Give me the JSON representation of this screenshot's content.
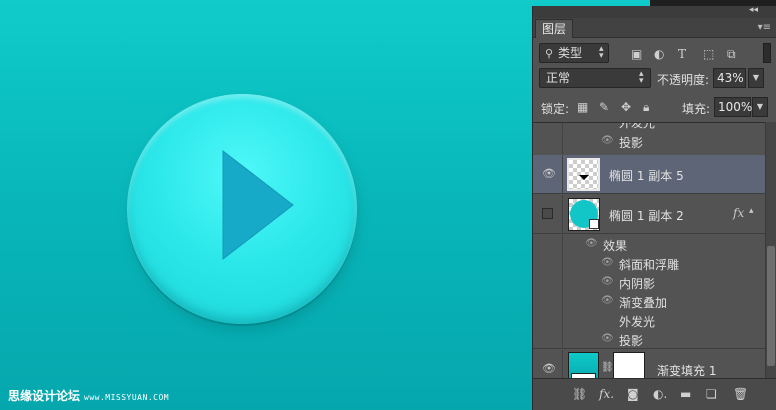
{
  "watermark": {
    "chinese": "思缘设计论坛",
    "url": "www.MISSYUAN.COM"
  },
  "panel": {
    "tab_title": "图层",
    "collapse_glyph": "◂◂",
    "close_glyph": "▸▸",
    "menu_glyph": "▾≡",
    "filter": {
      "label": "类型",
      "icons": [
        "image-filter-icon",
        "adjustment-filter-icon",
        "type-filter-icon",
        "shape-filter-icon",
        "smart-object-filter-icon"
      ]
    },
    "blend_mode": "正常",
    "opacity_label": "不透明度:",
    "opacity_value": "43%",
    "lock_label": "锁定:",
    "fill_label": "填充:",
    "fill_value": "100%",
    "layers": [
      {
        "type": "effect",
        "name": "外发光"
      },
      {
        "type": "effect",
        "name": "投影"
      },
      {
        "type": "layer",
        "name": "椭圆 1 副本 5",
        "selected": true,
        "visible": true
      },
      {
        "type": "layer",
        "name": "椭圆 1 副本 2",
        "selected": false,
        "visible": false,
        "fx": "fx"
      },
      {
        "type": "effects-header",
        "name": "效果"
      },
      {
        "type": "effect",
        "name": "斜面和浮雕"
      },
      {
        "type": "effect",
        "name": "内阴影"
      },
      {
        "type": "effect",
        "name": "渐变叠加"
      },
      {
        "type": "effect",
        "name": "外发光"
      },
      {
        "type": "effect",
        "name": "投影"
      },
      {
        "type": "layer",
        "name": "渐变填充 1",
        "visible": true
      }
    ],
    "bottom_icons": [
      "link-layers-icon",
      "add-style-icon",
      "add-mask-icon",
      "new-adjustment-icon",
      "new-group-icon",
      "new-layer-icon",
      "delete-layer-icon"
    ]
  },
  "colors": {
    "canvas_top": "#10cbca",
    "canvas_bottom": "#05a7ad",
    "circle": "#2de8ea",
    "play_triangle": "#17a9c8",
    "panel_bg": "#535353",
    "selected_row": "#5d6577"
  }
}
